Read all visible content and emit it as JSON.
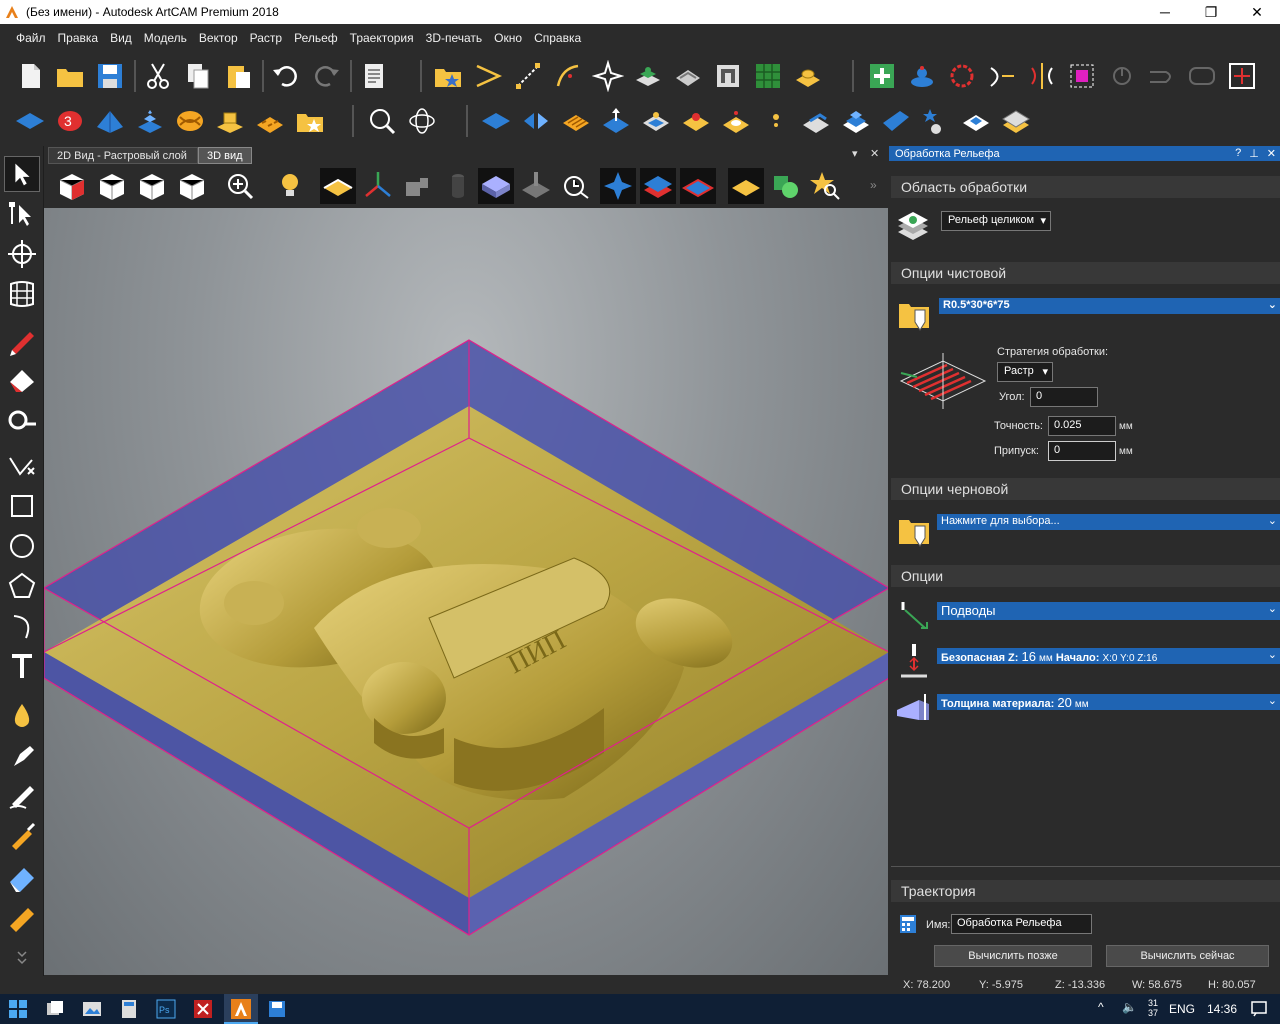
{
  "window": {
    "title": "(Без имени) - Autodesk ArtCAM Premium 2018",
    "minimize": "─",
    "maximize": "❐",
    "close": "✕"
  },
  "menu": [
    "Файл",
    "Правка",
    "Вид",
    "Модель",
    "Вектор",
    "Растр",
    "Рельеф",
    "Траектория",
    "3D-печать",
    "Окно",
    "Справка"
  ],
  "tabs": {
    "tab_2d": "2D Вид - Растровый слой",
    "tab_3d": "3D вид",
    "tab_close": "✕",
    "tab_dropdown": "▾"
  },
  "model_relief_text": "ПИП",
  "panel": {
    "title": "Обработка Рельефа",
    "help": "?",
    "pin": "⊥",
    "close": "✕",
    "area": {
      "heading": "Область обработки",
      "selection": "Рельеф целиком"
    },
    "finish": {
      "heading": "Опции чистовой",
      "tool": "R0.5*30*6*75",
      "strategy_label": "Стратегия обработки:",
      "strategy_value": "Растр",
      "angle_label": "Угол:",
      "angle_value": "0",
      "tolerance_label": "Точность:",
      "tolerance_value": "0.025",
      "tolerance_unit": "мм",
      "allowance_label": "Припуск:",
      "allowance_value": "0",
      "allowance_unit": "мм"
    },
    "rough": {
      "heading": "Опции черновой",
      "tool_prompt": "Нажмите для выбора..."
    },
    "options": {
      "heading": "Опции",
      "leads": "Подводы",
      "safe_z_label": "Безопасная Z:",
      "safe_z_value": "16",
      "safe_z_unit": "мм",
      "start_label": "Начало:",
      "start_value": "X:0 Y:0 Z:16",
      "thickness_label": "Толщина материала:",
      "thickness_value": "20",
      "thickness_unit": "мм"
    },
    "toolpath": {
      "heading": "Траектория",
      "name_label": "Имя:",
      "name_value": "Обработка Рельефа",
      "later_button": "Вычислить позже",
      "now_button": "Вычислить сейчас"
    }
  },
  "status": {
    "x": "X: 78.200",
    "y": "Y: -5.975",
    "z": "Z: -13.336",
    "w": "W: 58.675",
    "h": "H: 80.057"
  },
  "taskbar": {
    "language": "ENG",
    "time": "14:36",
    "temp_top": "31",
    "temp_bottom": "37"
  },
  "colors": {
    "accent_blue": "#1f64b3",
    "material": "#c9b457",
    "block_side": "#5b62a8",
    "block_edge": "#e0208c"
  }
}
